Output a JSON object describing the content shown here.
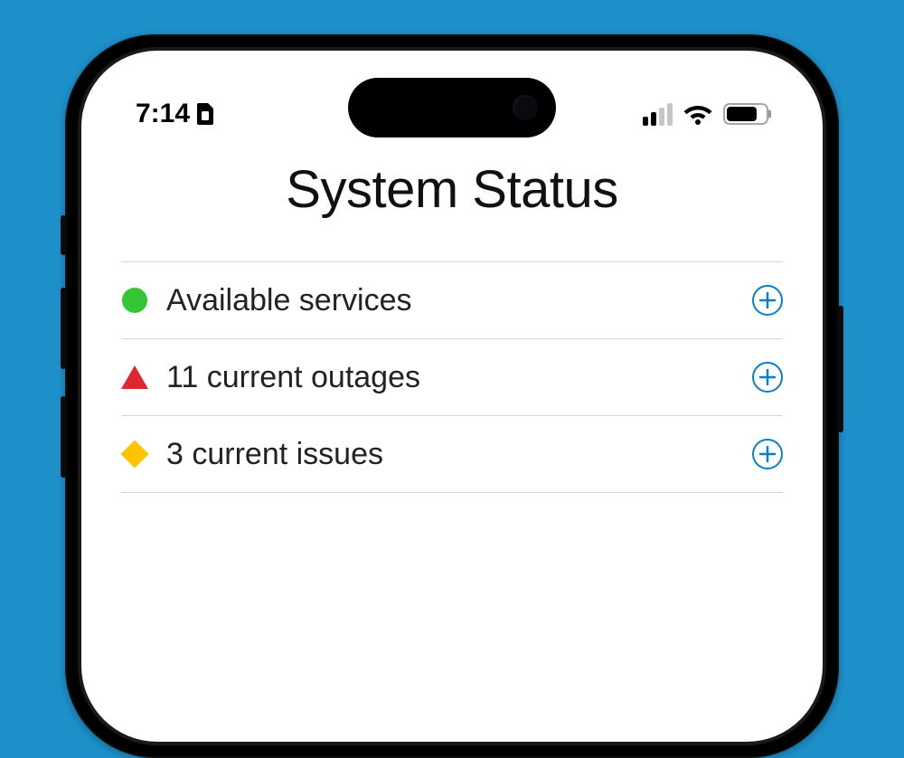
{
  "status_bar": {
    "time": "7:14",
    "cellular_active_bars": 2,
    "cellular_total_bars": 4,
    "wifi": true,
    "battery_percent": 78
  },
  "page": {
    "title": "System Status"
  },
  "rows": [
    {
      "icon": "available",
      "label": "Available services"
    },
    {
      "icon": "outage",
      "label": "11 current outages"
    },
    {
      "icon": "issue",
      "label": "3 current issues"
    }
  ],
  "colors": {
    "available": "#34c634",
    "outage": "#e0272e",
    "issue": "#fec400",
    "accent": "#0a7fc9"
  }
}
